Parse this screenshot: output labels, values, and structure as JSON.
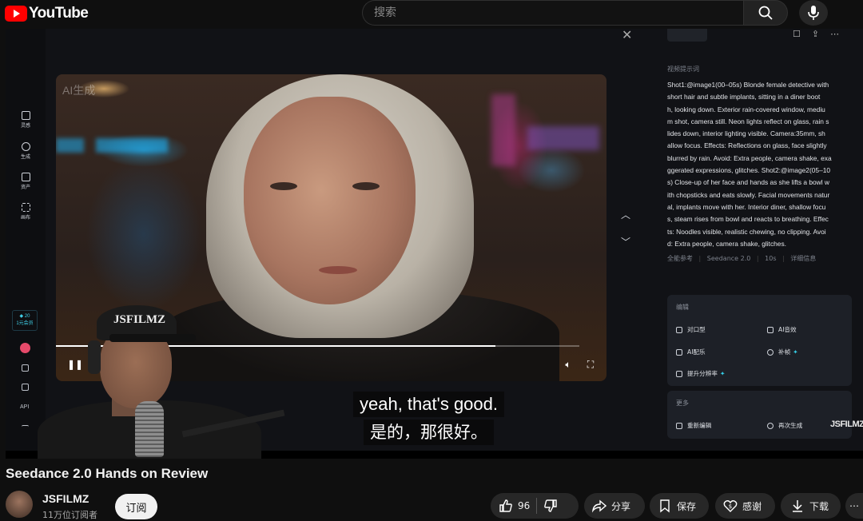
{
  "brand": {
    "name": "YouTube"
  },
  "search": {
    "placeholder": "搜索"
  },
  "video": {
    "title": "Seedance 2.0 Hands on Review",
    "progress_fraction": 0.84,
    "overlay_badge": "AI生成"
  },
  "app_ui": {
    "nav": [
      {
        "label": "灵感",
        "icon": "home-icon"
      },
      {
        "label": "生成",
        "icon": "sparkle-icon"
      },
      {
        "label": "资产",
        "icon": "folder-icon"
      },
      {
        "label": "画布",
        "icon": "grid-icon"
      }
    ],
    "credits": {
      "amount": "20",
      "label": "1元会员"
    },
    "api_label": "API",
    "prompt_label": "视频提示词",
    "prompt_lines": [
      "Shot1:@image1(00–05s) Blonde female detective with",
      "short hair and subtle implants, sitting in a diner boot",
      "h, looking down. Exterior rain-covered window, mediu",
      "m shot, camera still. Neon lights reflect on glass, rain s",
      "lides down, interior lighting visible. Camera:35mm, sh",
      "allow focus. Effects: Reflections on glass, face slightly",
      "blurred by rain. Avoid: Extra people, camera shake, exa",
      "ggerated expressions, glitches. Shot2:@image2(05–10",
      "s) Close-up of her face and hands as she lifts a bowl w",
      "ith chopsticks and eats slowly. Facial movements natur",
      "al, implants move with her. Interior diner, shallow focu",
      "s, steam rises from bowl and reacts to breathing. Effec",
      "ts: Noodles visible, realistic chewing, no clipping. Avoi",
      "d: Extra people, camera shake, glitches."
    ],
    "meta": {
      "ref": "全能参考",
      "model": "Seedance 2.0",
      "duration": "10s",
      "details": "详细信息"
    },
    "edit_card": {
      "title": "编辑",
      "options": [
        "对口型",
        "AI音效",
        "AI配乐",
        "补帧",
        "提升分辨率"
      ]
    },
    "more_card": {
      "title": "更多",
      "options": [
        "重新编辑",
        "再次生成"
      ]
    },
    "watermark": "JSFILMZ"
  },
  "webcam": {
    "cap_text": "JSFILMZ"
  },
  "subtitles": {
    "en": "yeah, that's good.",
    "zh": "是的，那很好。"
  },
  "channel": {
    "name": "JSFILMZ",
    "subscribers": "11万位订阅者",
    "subscribe_label": "订阅"
  },
  "actions": {
    "likes": "96",
    "share": "分享",
    "save": "保存",
    "thanks": "感谢",
    "download": "下载"
  },
  "colors": {
    "brand_red": "#ff0000",
    "accent_cyan": "#35cfe8",
    "background": "#0f0f0f"
  }
}
